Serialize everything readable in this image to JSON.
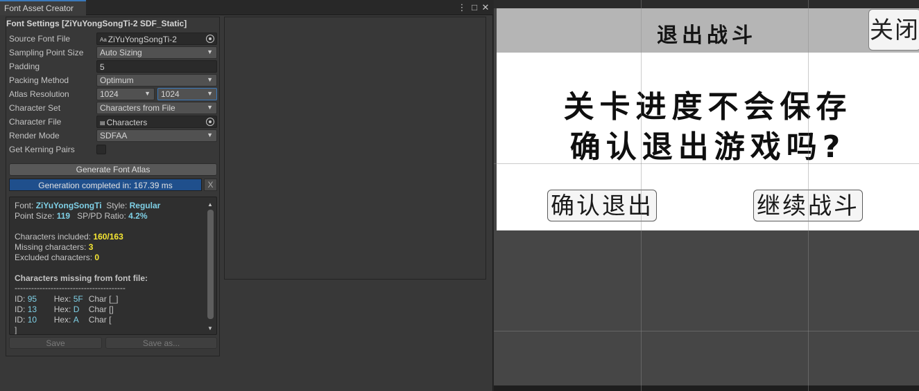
{
  "window": {
    "tab_title": "Font Asset Creator",
    "menu_glyph": "⋮",
    "maximize_glyph": "□",
    "close_glyph": "✕"
  },
  "settings": {
    "section_title": "Font Settings [ZiYuYongSongTi-2 SDF_Static]",
    "source_font_file": {
      "label": "Source Font File",
      "value": "ZiYuYongSongTi-2",
      "icon": "font-asset-icon"
    },
    "sampling_point_size": {
      "label": "Sampling Point Size",
      "value": "Auto Sizing"
    },
    "padding": {
      "label": "Padding",
      "value": "5"
    },
    "packing_method": {
      "label": "Packing Method",
      "value": "Optimum"
    },
    "atlas_resolution": {
      "label": "Atlas Resolution",
      "width": "1024",
      "height": "1024"
    },
    "character_set": {
      "label": "Character Set",
      "value": "Characters from File"
    },
    "character_file": {
      "label": "Character File",
      "value": "Characters",
      "icon": "text-file-icon"
    },
    "render_mode": {
      "label": "Render Mode",
      "value": "SDFAA"
    },
    "get_kerning_pairs": {
      "label": "Get Kerning Pairs",
      "checked": false
    },
    "generate_button": "Generate Font Atlas",
    "progress": {
      "text": "Generation completed in: 167.39 ms",
      "fraction": 1.0,
      "clear_label": "X"
    },
    "save_button": "Save",
    "save_as_button": "Save as..."
  },
  "report": {
    "font_label": "Font:",
    "font_value": "ZiYuYongSongTi",
    "style_label": "Style:",
    "style_value": "Regular",
    "point_size_label": "Point Size:",
    "point_size_value": "119",
    "ratio_label": "SP/PD Ratio:",
    "ratio_value": "4.2%",
    "included_label": "Characters included:",
    "included_value": "160/163",
    "missing_label": "Missing characters:",
    "missing_value": "3",
    "excluded_label": "Excluded characters:",
    "excluded_value": "0",
    "missing_header": "Characters missing from font file:",
    "separator": "----------------------------------------",
    "missing_rows": [
      {
        "id_label": "ID:",
        "id": "95",
        "hex_label": "Hex:",
        "hex": "5F",
        "char": "Char [_]"
      },
      {
        "id_label": "ID:",
        "id": "13",
        "hex_label": "Hex:",
        "hex": "D",
        "char": "Char []"
      },
      {
        "id_label": "ID:",
        "id": "10",
        "hex_label": "Hex:",
        "hex": "A",
        "char": "Char ["
      }
    ],
    "trailing": "]"
  },
  "game": {
    "title": "退出战斗",
    "close_button": "关闭",
    "message_line1": "关卡进度不会保存",
    "message_line2": "确认退出游戏吗?",
    "confirm_button": "确认退出",
    "continue_button": "继续战斗"
  },
  "colors": {
    "accent_blue": "#3a79bb",
    "progress_fill": "#1f4f8c",
    "value_cyan": "#7fd0e6",
    "warning_yellow": "#f5e633",
    "game_header": "#b5b5b5"
  }
}
